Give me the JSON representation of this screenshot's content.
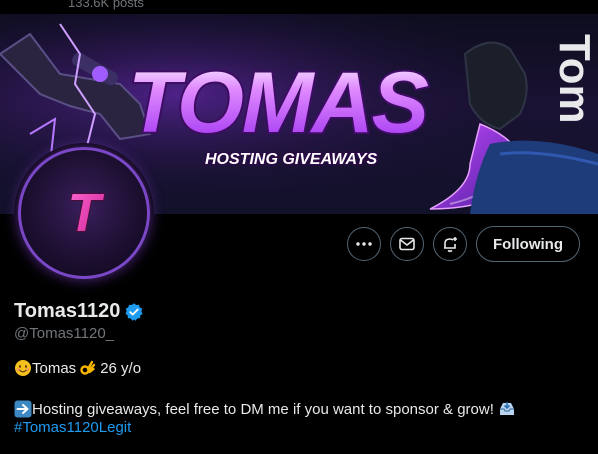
{
  "header": {
    "posts_count": "133.6K posts"
  },
  "banner": {
    "title": "TOMAS",
    "subtitle": "HOSTING GIVEAWAYS",
    "side_text": "Tom"
  },
  "avatar": {
    "letter": "T"
  },
  "actions": {
    "more_icon": "more-icon",
    "message_icon": "envelope-icon",
    "notify_icon": "bell-plus-icon",
    "follow_label": "Following"
  },
  "profile": {
    "display_name": "Tomas1120",
    "verified": true,
    "handle": "@Tomas1120_",
    "bio_line1_name": "Tomas",
    "bio_line1_age": "26 y/o",
    "bio_line2_text": "Hosting giveaways, feel free to DM me if you want to sponsor & grow!",
    "hashtag": "#Tomas1120Legit"
  },
  "colors": {
    "accent_blue": "#1d9bf0",
    "verified_blue": "#1d9bf0",
    "banner_purple": "#b03cff",
    "banner_pink": "#ff3cd0"
  }
}
